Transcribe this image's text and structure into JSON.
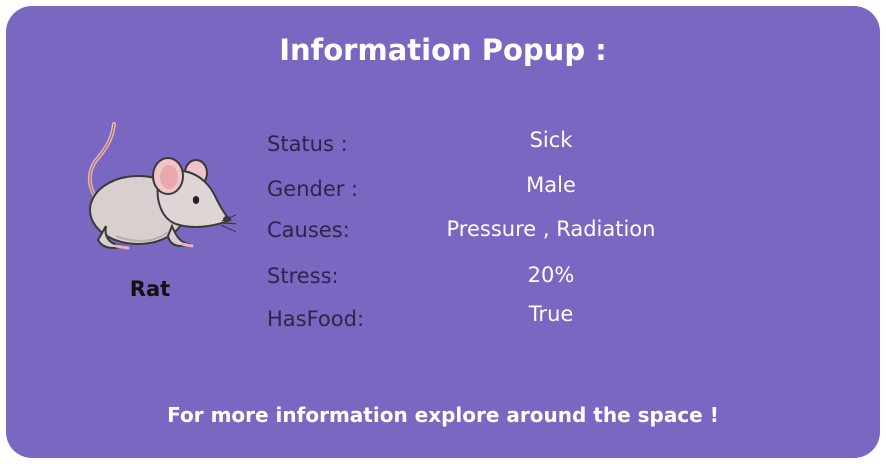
{
  "popup": {
    "title": "Information Popup :",
    "background_color": "#7a67c2",
    "footer": "For more information explore around the space !"
  },
  "subject": {
    "name": "Rat",
    "icon": "rat-illustration"
  },
  "fields": [
    {
      "label": "Status :",
      "value": "Sick"
    },
    {
      "label": "Gender :",
      "value": "Male"
    },
    {
      "label": "Causes:",
      "value": "Pressure , Radiation"
    },
    {
      "label": "Stress:",
      "value": "20%"
    },
    {
      "label": "HasFood:",
      "value": "True"
    }
  ]
}
